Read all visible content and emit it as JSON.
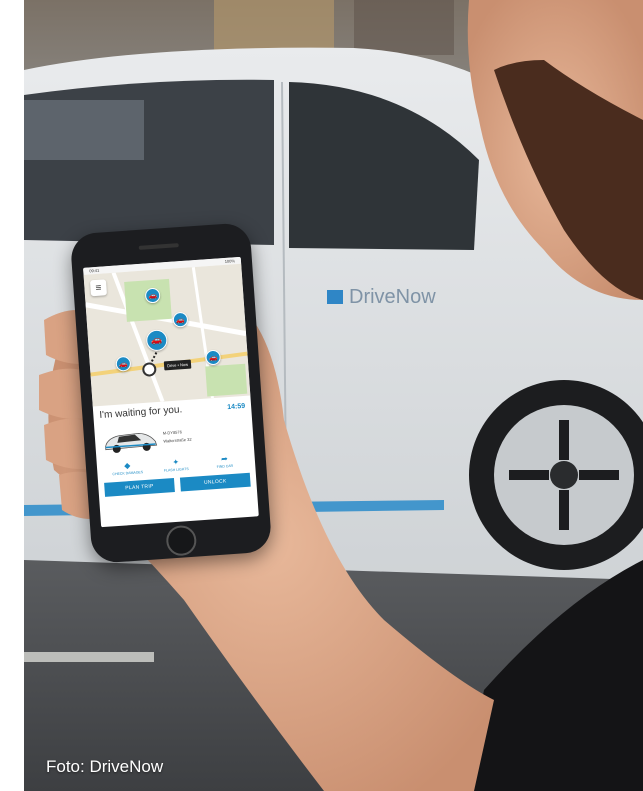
{
  "caption": "Foto: DriveNow",
  "car_branding": "DriveNow",
  "app": {
    "status_time": "09:41",
    "status_battery": "100%",
    "tooltip": "Drive • Now",
    "waiting_text": "I'm waiting for you.",
    "countdown": "14:59",
    "car_plate": "M-DY8576",
    "car_location": "Waltorstraße 32",
    "actions": [
      {
        "label": "CHECK DAMAGES",
        "icon": "damage-icon"
      },
      {
        "label": "FLASH LIGHTS",
        "icon": "lights-icon"
      },
      {
        "label": "FIND CAR",
        "icon": "find-car-icon"
      }
    ],
    "plan_trip_label": "PLAN TRIP",
    "unlock_label": "UNLOCK"
  },
  "colors": {
    "accent": "#1b8ac4"
  }
}
